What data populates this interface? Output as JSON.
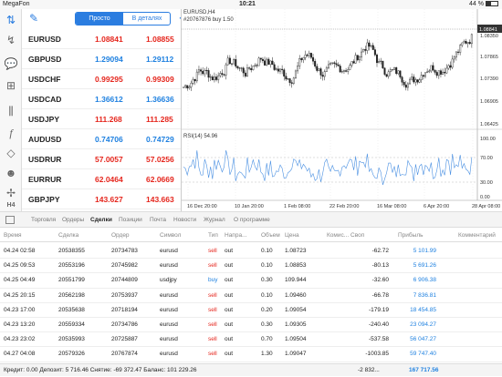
{
  "status": {
    "carrier": "MegaFon",
    "time": "10:21",
    "battery": "44 %"
  },
  "quotes": {
    "mode_simple": "Просто",
    "mode_detail": "В деталях",
    "rows": [
      {
        "symbol": "EURUSD",
        "bid": "1.08841",
        "ask": "1.08855",
        "color": "red"
      },
      {
        "symbol": "GBPUSD",
        "bid": "1.29094",
        "ask": "1.29112",
        "color": "blue"
      },
      {
        "symbol": "USDCHF",
        "bid": "0.99295",
        "ask": "0.99309",
        "color": "red"
      },
      {
        "symbol": "USDCAD",
        "bid": "1.36612",
        "ask": "1.36636",
        "color": "blue"
      },
      {
        "symbol": "USDJPY",
        "bid": "111.268",
        "ask": "111.285",
        "color": "red"
      },
      {
        "symbol": "AUDUSD",
        "bid": "0.74706",
        "ask": "0.74729",
        "color": "blue"
      },
      {
        "symbol": "USDRUR",
        "bid": "57.0057",
        "ask": "57.0256",
        "color": "red"
      },
      {
        "symbol": "EURRUR",
        "bid": "62.0464",
        "ask": "62.0669",
        "color": "red"
      },
      {
        "symbol": "GBPJPY",
        "bid": "143.627",
        "ask": "143.663",
        "color": "red"
      }
    ]
  },
  "chart": {
    "title": "EURUSD,H4",
    "order": "#20767876 buy 1.50",
    "rsi_label": "RSI(14) 54.96",
    "price_ticks": [
      "1.08855",
      "1.08350",
      "1.07865",
      "1.07390",
      "1.06905",
      "1.06425",
      "1.05945",
      "1.05465"
    ],
    "rsi_ticks": [
      "100.00",
      "70.00",
      "30.00",
      "0.00"
    ],
    "time_ticks": [
      "16 Dec 20:00",
      "10 Jan 20:00",
      "1 Feb 08:00",
      "22 Feb 20:00",
      "16 Mar 08:00",
      "6 Apr 20:00",
      "28 Apr 08:00"
    ],
    "timeframe": "H4"
  },
  "tabs": [
    "Торговля",
    "Ордеры",
    "Сделки",
    "Позиции",
    "Почта",
    "Новости",
    "Журнал",
    "О программе"
  ],
  "active_tab": "Сделки",
  "table": {
    "headers": [
      "Время",
      "Сделка",
      "Ордер",
      "Символ",
      "Тип",
      "Напра...",
      "Объем",
      "Цена",
      "Комис...",
      "Своп",
      "Прибыль",
      "Комментарий"
    ],
    "rows": [
      [
        "04.24 02:58",
        "20538355",
        "20734783",
        "eurusd",
        "sell",
        "out",
        "0.10",
        "1.08723",
        "",
        "-62.72",
        "5 101.99",
        ""
      ],
      [
        "04.25 09:53",
        "20553196",
        "20745982",
        "eurusd",
        "sell",
        "out",
        "0.10",
        "1.08853",
        "",
        "-80.13",
        "5 691.26",
        ""
      ],
      [
        "04.25 04:49",
        "20551799",
        "20744809",
        "usdjpy",
        "buy",
        "out",
        "0.30",
        "109.944",
        "",
        "-32.60",
        "6 906.38",
        ""
      ],
      [
        "04.25 20:15",
        "20562198",
        "20753937",
        "eurusd",
        "sell",
        "out",
        "0.10",
        "1.09460",
        "",
        "-66.78",
        "7 836.81",
        ""
      ],
      [
        "04.23 17:00",
        "20535638",
        "20718194",
        "eurusd",
        "sell",
        "out",
        "0.20",
        "1.09054",
        "",
        "-179.19",
        "18 454.85",
        ""
      ],
      [
        "04.23 13:20",
        "20559334",
        "20734786",
        "eurusd",
        "sell",
        "out",
        "0.30",
        "1.09305",
        "",
        "-240.40",
        "23 094.27",
        ""
      ],
      [
        "04.23 23:02",
        "20535993",
        "20725887",
        "eurusd",
        "sell",
        "out",
        "0.70",
        "1.09504",
        "",
        "-537.58",
        "56 047.27",
        ""
      ],
      [
        "04.27 04:08",
        "20579326",
        "20767874",
        "eurusd",
        "sell",
        "out",
        "1.30",
        "1.09047",
        "",
        "-1003.85",
        "59 747.40",
        ""
      ]
    ]
  },
  "footer": {
    "summary": "Кредит: 0.00 Депозит: 5 716.46 Снятие: -69 372.47 Баланс: 101 229.26",
    "swap_total": "-2 832...",
    "profit_total": "167 717.56"
  }
}
